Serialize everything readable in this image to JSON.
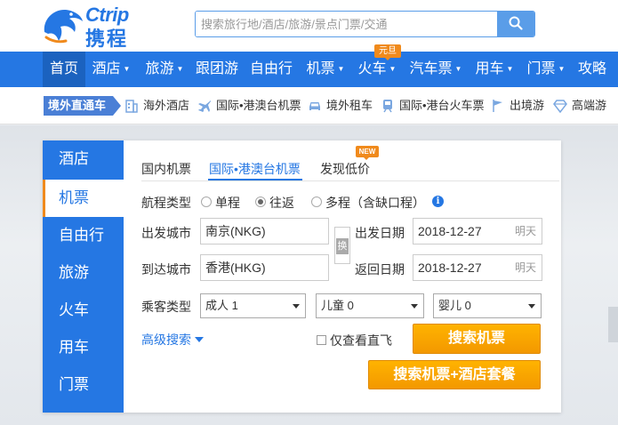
{
  "header": {
    "logo_en": "Ctrip",
    "logo_cn": "携程",
    "search_placeholder": "搜索旅行地/酒店/旅游/景点门票/交通"
  },
  "nav": {
    "items": [
      {
        "label": "首页",
        "caret": ""
      },
      {
        "label": "酒店",
        "caret": "▼"
      },
      {
        "label": "旅游",
        "caret": "▼"
      },
      {
        "label": "跟团游",
        "caret": ""
      },
      {
        "label": "自由行",
        "caret": ""
      },
      {
        "label": "机票",
        "caret": "▼"
      },
      {
        "label": "火车",
        "caret": "▼"
      },
      {
        "label": "汽车票",
        "caret": "▼"
      },
      {
        "label": "用车",
        "caret": "▼"
      },
      {
        "label": "门票",
        "caret": "▼"
      },
      {
        "label": "攻略",
        "caret": ""
      }
    ],
    "badge": "元旦"
  },
  "subnav": {
    "tag": "境外直通车",
    "items": [
      {
        "label": "海外酒店",
        "icon": "building-icon"
      },
      {
        "label": "国际•港澳台机票",
        "icon": "airplane-icon"
      },
      {
        "label": "境外租车",
        "icon": "car-icon"
      },
      {
        "label": "国际•港台火车票",
        "icon": "train-icon"
      },
      {
        "label": "出境游",
        "icon": "flag-icon"
      },
      {
        "label": "高端游",
        "icon": "diamond-icon"
      }
    ]
  },
  "panel": {
    "sidebar": [
      "酒店",
      "机票",
      "自由行",
      "旅游",
      "火车",
      "用车",
      "门票"
    ],
    "tabs": [
      "国内机票",
      "国际•港澳台机票",
      "发现低价"
    ],
    "new_badge": "NEW",
    "trip_type_label": "航程类型",
    "trip_types": [
      "单程",
      "往返",
      "多程（含缺口程）"
    ],
    "from_label": "出发城市",
    "from_value": "南京(NKG)",
    "to_label": "到达城市",
    "to_value": "香港(HKG)",
    "swap_label": "换",
    "depart_label": "出发日期",
    "depart_value": "2018-12-27",
    "depart_hint": "明天",
    "return_label": "返回日期",
    "return_value": "2018-12-27",
    "return_hint": "明天",
    "passenger_label": "乘客类型",
    "adult": "成人 1",
    "child": "儿童 0",
    "infant": "婴儿 0",
    "advanced": "高级搜索",
    "direct_only": "仅查看直飞",
    "search_btn": "搜索机票",
    "package_btn": "搜索机票+酒店套餐"
  }
}
